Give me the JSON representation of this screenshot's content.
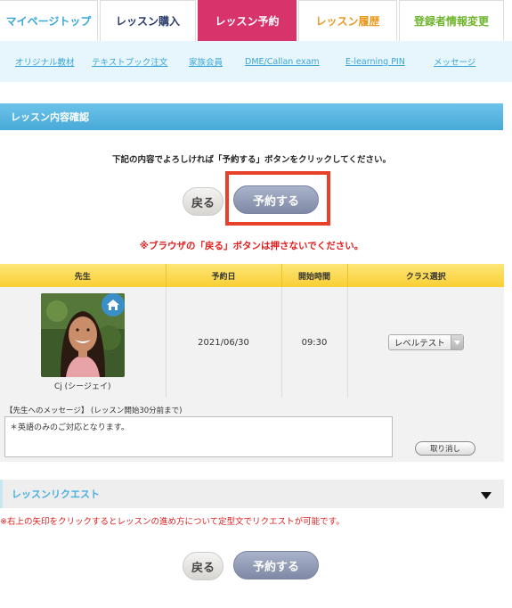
{
  "tabs": [
    {
      "label": "マイページトップ"
    },
    {
      "label": "レッスン購入"
    },
    {
      "label": "レッスン予約"
    },
    {
      "label": "レッスン履歴"
    },
    {
      "label": "登録者情報変更"
    }
  ],
  "subnav": [
    {
      "label": "オリジナル教材"
    },
    {
      "label": "テキストブック注文"
    },
    {
      "label": "家族会員"
    },
    {
      "label": "DME/Callan exam"
    },
    {
      "label": "E-learning PIN"
    },
    {
      "label": "メッセージ"
    }
  ],
  "section_title": "レッスン内容確認",
  "instruction": "下記の内容でよろしければ「予約する」ボタンをクリックしてください。",
  "buttons": {
    "back": "戻る",
    "reserve": "予約する",
    "cancel": "取り消し"
  },
  "warning": "※ブラウザの「戻る」ボタンは押さないでください。",
  "table": {
    "headers": {
      "teacher": "先生",
      "date": "予約日",
      "time": "開始時間",
      "class": "クラス選択"
    },
    "row": {
      "teacher_name": "Cj (シージェイ)",
      "date": "2021/06/30",
      "time": "09:30",
      "class_selected": "レベルテスト"
    }
  },
  "message": {
    "label": "【先生へのメッセージ】 (レッスン開始30分前まで)",
    "text": "＊英語のみのご対応となります。"
  },
  "request": {
    "title": "レッスンリクエスト",
    "note": "※右上の矢印をクリックするとレッスンの進め方について定型文でリクエストが可能です。"
  },
  "colors": {
    "accent_pink": "#d9336b",
    "header_blue": "#48a9d8",
    "warning_red": "#e02020",
    "table_yellow": "#f9cf35"
  },
  "icons": {
    "home": "home-icon",
    "dropdown": "triangle-down-icon",
    "expand": "triangle-down-icon"
  }
}
